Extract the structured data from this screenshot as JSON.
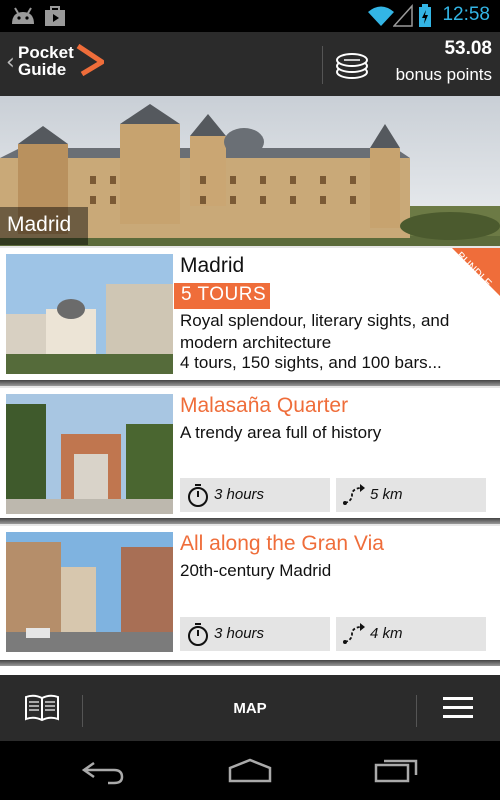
{
  "status_bar": {
    "time": "12:58"
  },
  "header": {
    "app_name_line1": "Pocket",
    "app_name_line2": "Guide",
    "points_value": "53.08",
    "points_label": "bonus points"
  },
  "hero": {
    "city": "Madrid"
  },
  "bundle_card": {
    "title": "Madrid",
    "tours_badge": "5 TOURS",
    "ribbon": "BUNDLE",
    "desc_line1": "Royal splendour, literary sights, and",
    "desc_line2": "modern architecture",
    "desc_line3": "4 tours, 150 sights, and 100 bars..."
  },
  "tours": [
    {
      "title": "Malasaña Quarter",
      "subtitle": "A trendy area full of history",
      "duration": "3 hours",
      "distance": "5 km"
    },
    {
      "title": "All along the Gran Via",
      "subtitle": "20th-century Madrid",
      "duration": "3 hours",
      "distance": "4 km"
    }
  ],
  "toolbar": {
    "map_label": "MAP"
  },
  "icons": [
    "android-icon",
    "store-icon",
    "wifi-icon",
    "signal-icon",
    "battery-icon",
    "back-chevron-icon",
    "logo-arrow-icon",
    "coins-icon",
    "stopwatch-icon",
    "route-icon",
    "book-icon",
    "menu-icon",
    "nav-back-icon",
    "nav-home-icon",
    "nav-recents-icon"
  ],
  "colors": {
    "accent": "#ef6d3a",
    "status_blue": "#33b5e5",
    "bar": "#2b2b2b"
  }
}
